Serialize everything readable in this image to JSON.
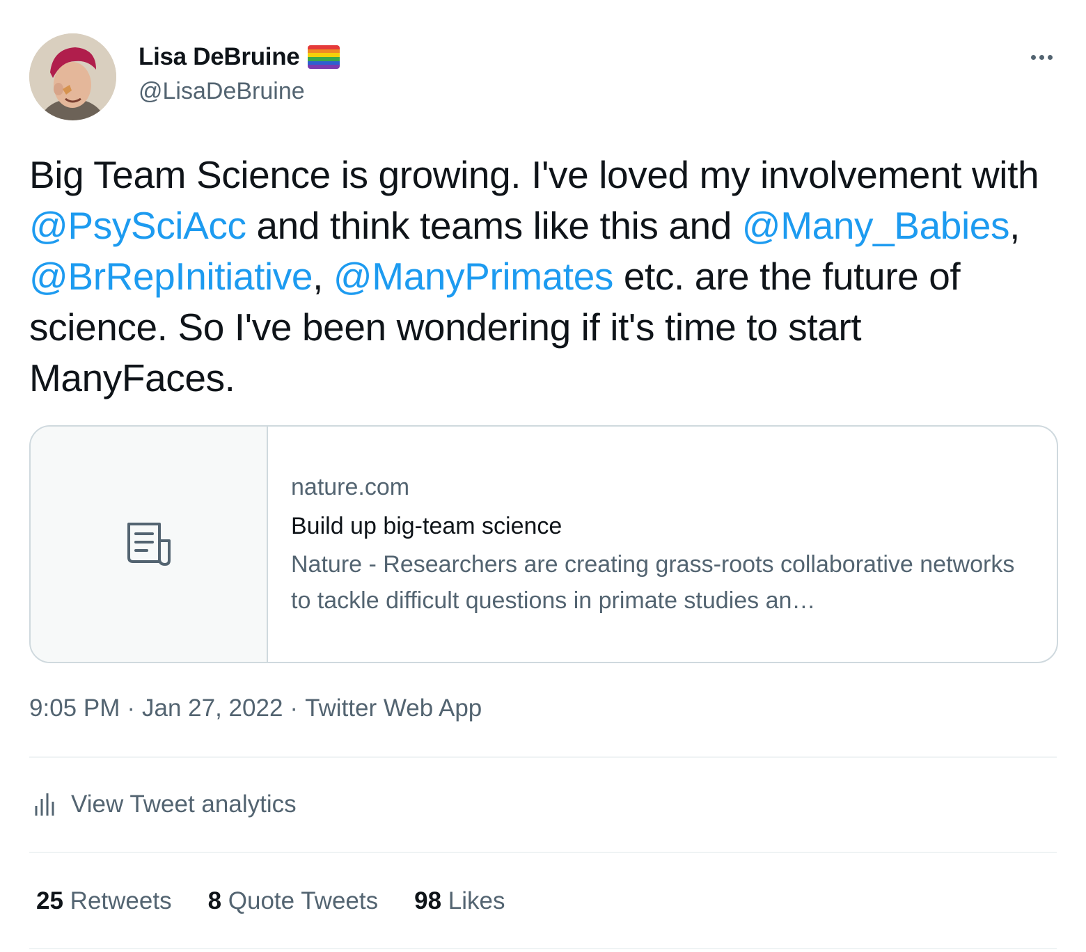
{
  "author": {
    "display_name": "Lisa DeBruine",
    "handle": "@LisaDeBruine",
    "avatar_icon": "profile-photo",
    "badge_icon": "rainbow-flag-icon"
  },
  "tweet": {
    "text_1": "Big Team Science is growing. I've loved my involvement with ",
    "mention_1": "@PsySciAcc",
    "text_2": " and think teams like this and ",
    "mention_2": "@Many_Babies",
    "sep_1": ", ",
    "mention_3": "@BrRepInitiative",
    "sep_2": ", ",
    "mention_4": "@ManyPrimates",
    "text_3": " etc. are the future of science. So I've been wondering if it's time to start ManyFaces."
  },
  "card": {
    "domain": "nature.com",
    "title": "Build up big-team science",
    "description": "Nature - Researchers are creating grass-roots collaborative networks to tackle difficult questions in primate studies an…",
    "thumb_icon": "article-icon"
  },
  "meta": {
    "time": "9:05 PM",
    "dot_1": "·",
    "date": "Jan 27, 2022",
    "dot_2": "·",
    "source": "Twitter Web App"
  },
  "analytics": {
    "label": "View Tweet analytics",
    "icon": "analytics-bars-icon"
  },
  "stats": {
    "retweets_count": "25",
    "retweets_label": "Retweets",
    "quotes_count": "8",
    "quotes_label": "Quote Tweets",
    "likes_count": "98",
    "likes_label": "Likes"
  },
  "colors": {
    "link": "#1d9bf0",
    "text_primary": "#0f1419",
    "text_secondary": "#536471",
    "border": "#cfd9de"
  }
}
